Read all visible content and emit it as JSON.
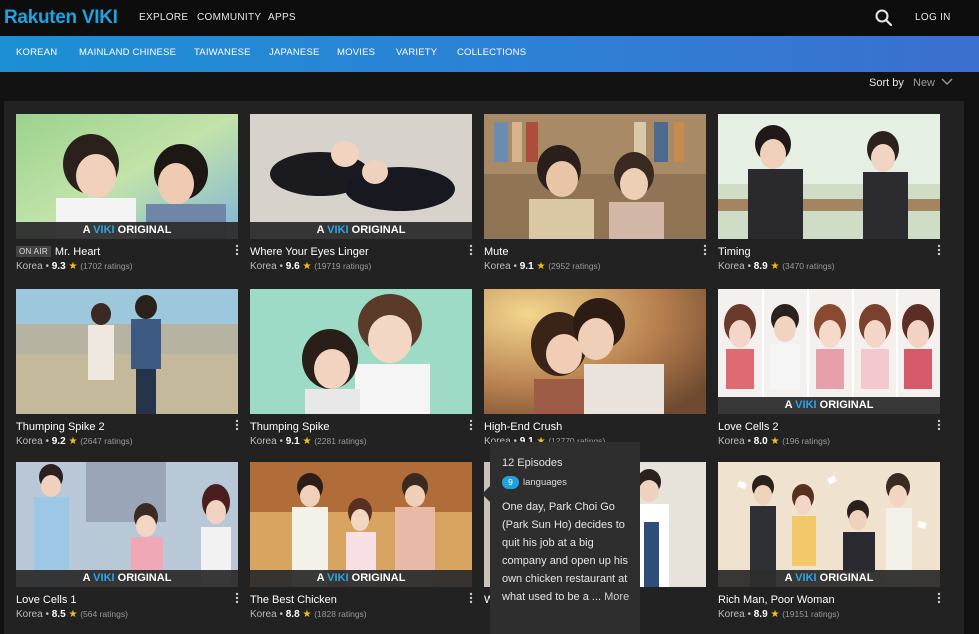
{
  "header": {
    "logo": {
      "rakuten": "Rakuten",
      "viki": "VIKI"
    },
    "nav": [
      "EXPLORE",
      "COMMUNITY",
      "APPS"
    ],
    "search_icon": "search-icon",
    "login": "LOG IN"
  },
  "categories": [
    "KOREAN",
    "MAINLAND CHINESE",
    "TAIWANESE",
    "JAPANESE",
    "MOVIES",
    "VARIETY",
    "COLLECTIONS"
  ],
  "sort": {
    "label": "Sort by",
    "value": "New"
  },
  "badges": {
    "viki_original_a": "A ",
    "viki_original_v": "VIKI",
    "viki_original_o": " ORIGINAL",
    "on_air": "ON AIR"
  },
  "shows": [
    {
      "title": "Mr. Heart",
      "country": "Korea",
      "rating": "9.3",
      "ratings": "(1702 ratings)",
      "original": true,
      "on_air": true
    },
    {
      "title": "Where Your Eyes Linger",
      "country": "Korea",
      "rating": "9.6",
      "ratings": "(19719 ratings)",
      "original": true
    },
    {
      "title": "Mute",
      "country": "Korea",
      "rating": "9.1",
      "ratings": "(2952 ratings)",
      "original": false
    },
    {
      "title": "Timing",
      "country": "Korea",
      "rating": "8.9",
      "ratings": "(3470 ratings)",
      "original": false
    },
    {
      "title": "Thumping Spike 2",
      "country": "Korea",
      "rating": "9.2",
      "ratings": "(2647 ratings)",
      "original": false
    },
    {
      "title": "Thumping Spike",
      "country": "Korea",
      "rating": "9.1",
      "ratings": "(2281 ratings)",
      "original": false
    },
    {
      "title": "High-End Crush",
      "country": "Korea",
      "rating": "9.1",
      "ratings": "(12770 ratings)",
      "original": false
    },
    {
      "title": "Love Cells 2",
      "country": "Korea",
      "rating": "8.0",
      "ratings": "(196 ratings)",
      "original": true
    },
    {
      "title": "Love Cells 1",
      "country": "Korea",
      "rating": "8.5",
      "ratings": "(564 ratings)",
      "original": true
    },
    {
      "title": "The Best Chicken",
      "country": "Korea",
      "rating": "8.8",
      "ratings": "(1828 ratings)",
      "original": true
    },
    {
      "title": "W",
      "country": "",
      "rating": "",
      "ratings": "",
      "original": false
    },
    {
      "title": "Rich Man, Poor Woman",
      "country": "Korea",
      "rating": "8.9",
      "ratings": "(19151 ratings)",
      "original": true
    }
  ],
  "tooltip": {
    "episodes": "12 Episodes",
    "languages_count": "9",
    "languages_label": "languages",
    "description": "One day, Park Choi Go (Park Sun Ho) decides to quit his job at a big company and open up his own chicken restaurant at what used to be a ...",
    "more": "More"
  },
  "colors": {
    "accent": "#1fa3e0",
    "star": "#f3c116",
    "category_bar": "#2f7fd6"
  }
}
